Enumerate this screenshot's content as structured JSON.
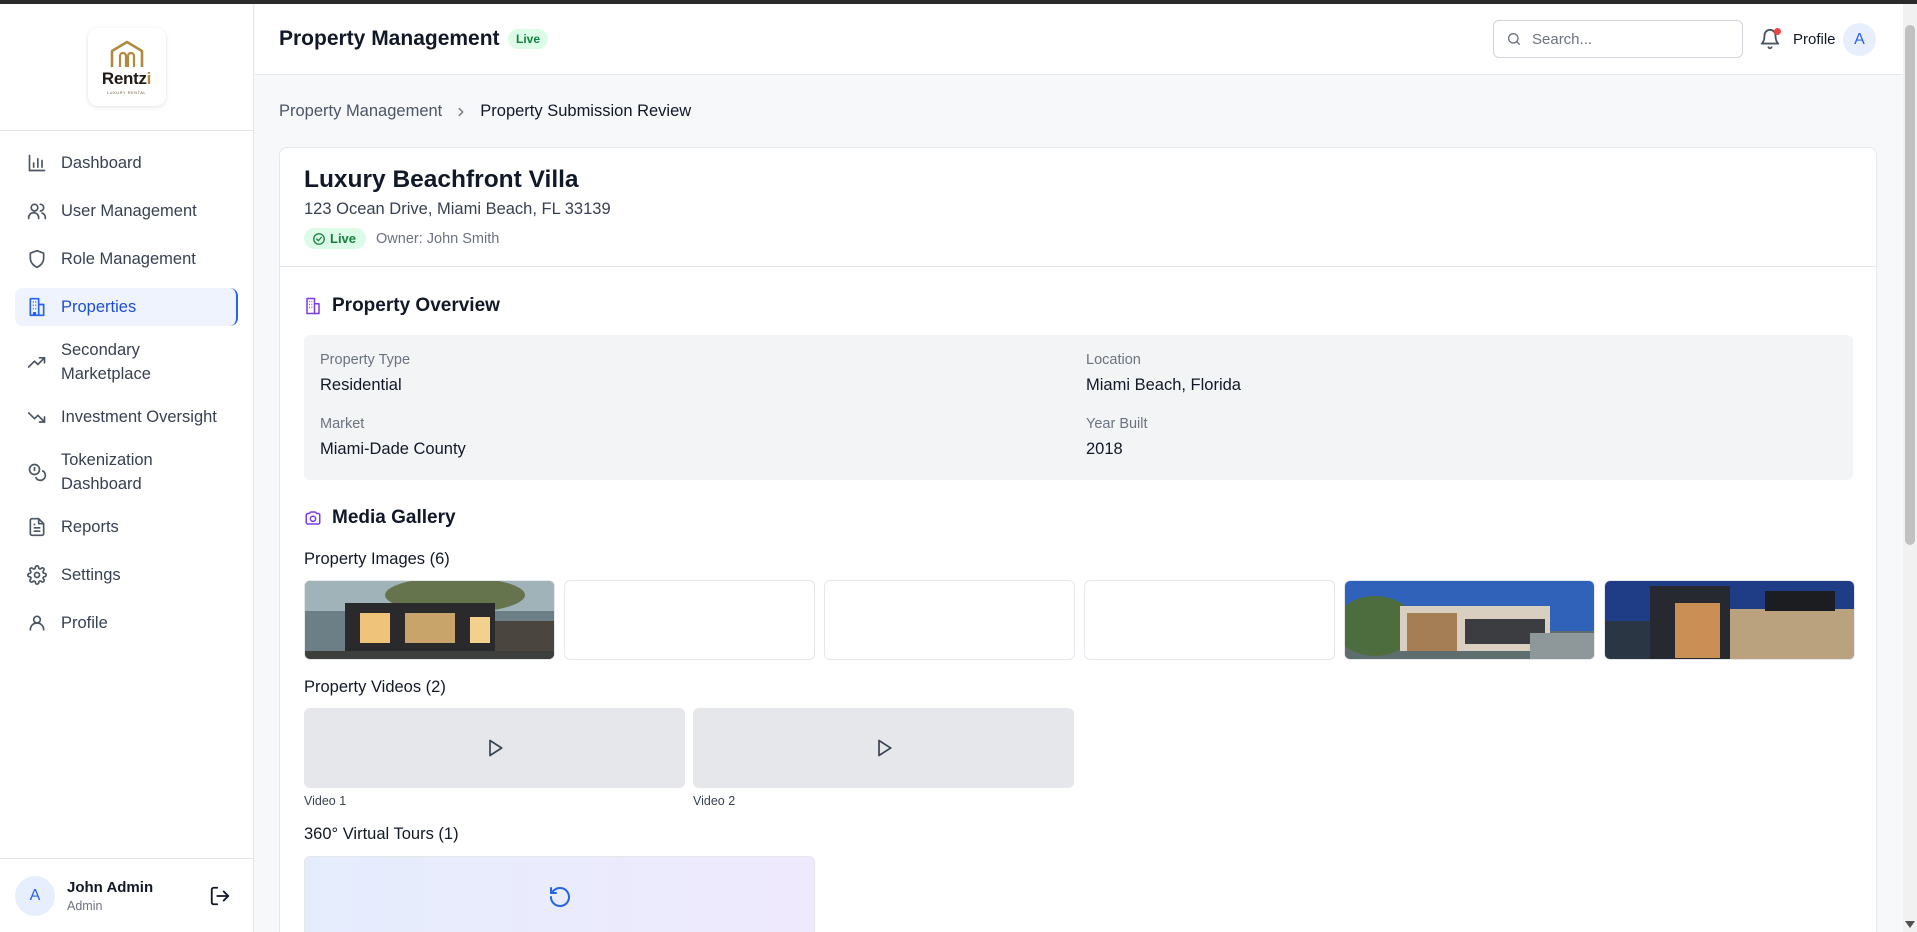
{
  "sidebar": {
    "logo": {
      "brand": "Rentz",
      "brand_accent": "i",
      "tagline": "LUXURY RENTAL"
    },
    "items": [
      {
        "label": "Dashboard",
        "icon": "bar-chart-icon",
        "active": false
      },
      {
        "label": "User Management",
        "icon": "users-icon",
        "active": false
      },
      {
        "label": "Role Management",
        "icon": "shield-icon",
        "active": false
      },
      {
        "label": "Properties",
        "icon": "building-icon",
        "active": true
      },
      {
        "label": "Secondary Marketplace",
        "icon": "trending-up-icon",
        "active": false
      },
      {
        "label": "Investment Oversight",
        "icon": "trending-down-icon",
        "active": false
      },
      {
        "label": "Tokenization Dashboard",
        "icon": "coins-icon",
        "active": false
      },
      {
        "label": "Reports",
        "icon": "file-text-icon",
        "active": false
      },
      {
        "label": "Settings",
        "icon": "gear-icon",
        "active": false
      },
      {
        "label": "Profile",
        "icon": "user-icon",
        "active": false
      }
    ],
    "user": {
      "initial": "A",
      "name": "John Admin",
      "role": "Admin"
    }
  },
  "header": {
    "title": "Property Management",
    "status_badge": "Live",
    "search_placeholder": "Search...",
    "profile_label": "Profile",
    "profile_initial": "A"
  },
  "breadcrumb": {
    "parent": "Property Management",
    "current": "Property Submission Review"
  },
  "property": {
    "name": "Luxury Beachfront Villa",
    "address": "123 Ocean Drive, Miami Beach, FL 33139",
    "status": "Live",
    "owner": "Owner: John Smith"
  },
  "overview": {
    "title": "Property Overview",
    "fields": [
      {
        "label": "Property Type",
        "value": "Residential"
      },
      {
        "label": "Location",
        "value": "Miami Beach, Florida"
      },
      {
        "label": "Market",
        "value": "Miami-Dade County"
      },
      {
        "label": "Year Built",
        "value": "2018"
      }
    ]
  },
  "media": {
    "title": "Media Gallery",
    "images_title": "Property Images (6)",
    "videos_title": "Property Videos (2)",
    "videos": [
      {
        "caption": "Video 1"
      },
      {
        "caption": "Video 2"
      }
    ],
    "tours_title": "360° Virtual Tours (1)"
  },
  "colors": {
    "accent": "#2563eb",
    "live_bg": "#dcfce7",
    "live_text": "#15803d",
    "section_icon": "#7c3aed"
  }
}
